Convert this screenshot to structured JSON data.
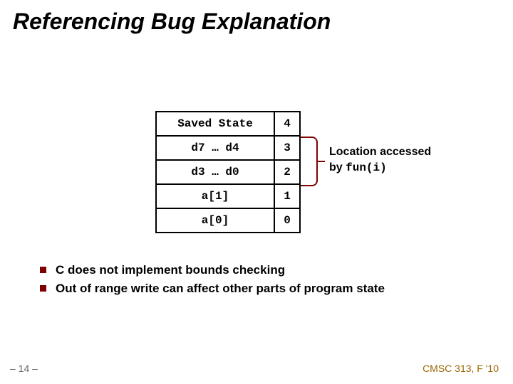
{
  "title": "Referencing Bug Explanation",
  "stack": {
    "rows": [
      {
        "content": "Saved State",
        "index": "4"
      },
      {
        "content": "d7 … d4",
        "index": "3"
      },
      {
        "content": "d3 … d0",
        "index": "2"
      },
      {
        "content": "a[1]",
        "index": "1"
      },
      {
        "content": "a[0]",
        "index": "0"
      }
    ]
  },
  "annotation": {
    "line1": "Location accessed",
    "line2_prefix": "by ",
    "line2_code": "fun(i)"
  },
  "bullets": [
    "C does not implement bounds checking",
    "Out of range write can affect other parts of program state"
  ],
  "page_number": "– 14 –",
  "course": "CMSC 313, F '10"
}
